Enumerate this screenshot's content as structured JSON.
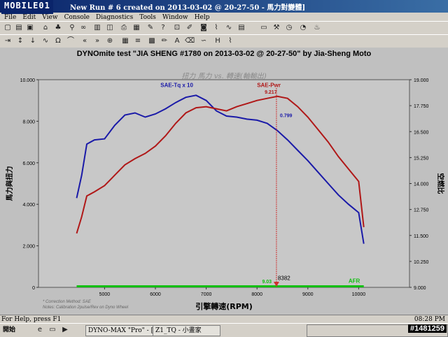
{
  "window": {
    "logo_text": "MOBILE01",
    "title": "New Run # 6 created on 2013-03-02 @ 20-27-50 - 馬力對變體]"
  },
  "menu": [
    "File",
    "Edit",
    "View",
    "Console",
    "Diagnostics",
    "Tools",
    "Window",
    "Help"
  ],
  "chart_header": {
    "title": "DYNOmite test \"JIA SHENG #1780 on 2013-03-02 @ 20-27-50\" by Jia-Sheng Moto",
    "subtitle": "扭力 馬力 vs. 轉速(軸輸出)"
  },
  "chart_data": {
    "type": "line",
    "xlabel": "引擎轉速(RPM)",
    "ylabel_left": "馬力與扭力",
    "ylabel_right": "空燃比",
    "xlim": [
      3700,
      11000
    ],
    "ylim_left": [
      0,
      10
    ],
    "ylim_right": [
      9.0,
      19.0
    ],
    "x_ticks": [
      "5000",
      "6000",
      "7000",
      "8000",
      "9000",
      "10000"
    ],
    "y_left_ticks": [
      "0",
      "2.000",
      "4.000",
      "6.000",
      "8.000",
      "10.000"
    ],
    "y_right_ticks": [
      "9.000",
      "10.250",
      "11.500",
      "12.750",
      "14.000",
      "15.250",
      "16.500",
      "17.750",
      "19.000"
    ],
    "series": [
      {
        "name": "SAE-Tq x 10",
        "color": "#1a1aa8",
        "x": [
          4450,
          4550,
          4650,
          4800,
          5000,
          5200,
          5400,
          5600,
          5800,
          6000,
          6200,
          6400,
          6600,
          6800,
          7000,
          7200,
          7400,
          7600,
          7800,
          8000,
          8200,
          8400,
          8600,
          8800,
          9000,
          9200,
          9400,
          9600,
          9800,
          10000,
          10100
        ],
        "values": [
          4.3,
          5.4,
          6.9,
          7.1,
          7.15,
          7.8,
          8.3,
          8.4,
          8.2,
          8.35,
          8.6,
          8.9,
          9.15,
          9.25,
          9.0,
          8.5,
          8.25,
          8.2,
          8.1,
          8.05,
          7.9,
          7.55,
          7.1,
          6.6,
          6.1,
          5.55,
          5.0,
          4.45,
          4.0,
          3.6,
          2.1
        ]
      },
      {
        "name": "SAE-Pwr",
        "color": "#b01818",
        "x": [
          4450,
          4550,
          4650,
          4800,
          5000,
          5200,
          5400,
          5600,
          5800,
          6000,
          6200,
          6400,
          6600,
          6800,
          7000,
          7200,
          7400,
          7600,
          7800,
          8000,
          8200,
          8400,
          8600,
          8800,
          9000,
          9200,
          9400,
          9600,
          9800,
          10000,
          10100
        ],
        "values": [
          2.6,
          3.4,
          4.4,
          4.6,
          4.9,
          5.4,
          5.9,
          6.2,
          6.45,
          6.8,
          7.3,
          7.9,
          8.4,
          8.65,
          8.7,
          8.6,
          8.5,
          8.7,
          8.85,
          9.0,
          9.1,
          9.2,
          9.1,
          8.7,
          8.2,
          7.6,
          7.0,
          6.3,
          5.7,
          5.1,
          2.9
        ]
      },
      {
        "name": "AFR",
        "color": "#10c010",
        "x": [
          4450,
          10100
        ],
        "values": [
          9.05,
          9.05
        ]
      }
    ],
    "annotations": {
      "cursor_rpm": "8382",
      "pwr_value": "9.217",
      "tq_value": "0.799",
      "afr_value": "9.03"
    },
    "notes": [
      "* Correction Method: SAE",
      "Notes: Calibration 2pulse/Rev on Dyno Wheel"
    ],
    "grid": false
  },
  "status": {
    "help": "For Help, press F1",
    "clock": "08:28 PM"
  },
  "taskbar": {
    "start": "開始",
    "tasks": [
      "DYNO-MAX \"Pro\" - [...",
      "Z1_TQ - 小畫家"
    ],
    "watermark": "#1481259"
  }
}
